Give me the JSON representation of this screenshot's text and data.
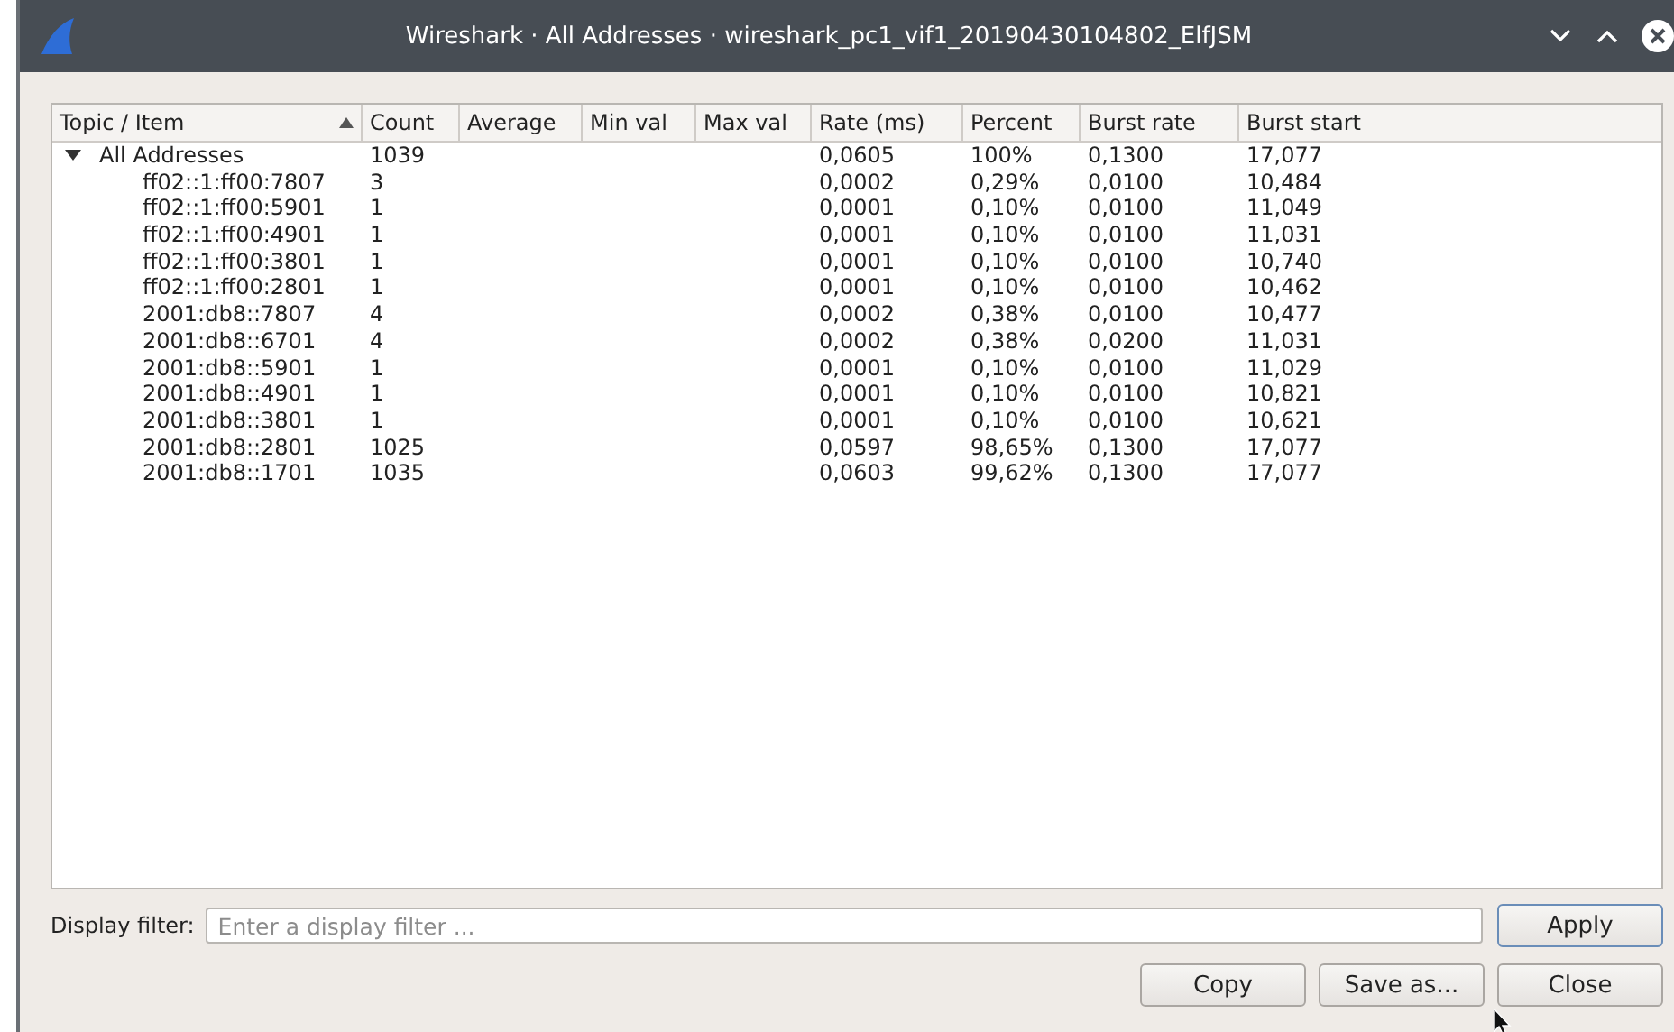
{
  "window": {
    "title": "Wireshark · All Addresses · wireshark_pc1_vif1_20190430104802_ElfJSM"
  },
  "table": {
    "columns": [
      {
        "label": "Topic / Item",
        "sorted": true
      },
      {
        "label": "Count",
        "sorted": false
      },
      {
        "label": "Average",
        "sorted": false
      },
      {
        "label": "Min val",
        "sorted": false
      },
      {
        "label": "Max val",
        "sorted": false
      },
      {
        "label": "Rate (ms)",
        "sorted": false
      },
      {
        "label": "Percent",
        "sorted": false
      },
      {
        "label": "Burst rate",
        "sorted": false
      },
      {
        "label": "Burst start",
        "sorted": false
      }
    ],
    "rows": [
      {
        "cells": [
          "All Addresses",
          "1039",
          "",
          "",
          "",
          "0,0605",
          "100%",
          "0,1300",
          "17,077"
        ],
        "expanded": true,
        "children": [
          {
            "cells": [
              "ff02::1:ff00:7807",
              "3",
              "",
              "",
              "",
              "0,0002",
              "0,29%",
              "0,0100",
              "10,484"
            ]
          },
          {
            "cells": [
              "ff02::1:ff00:5901",
              "1",
              "",
              "",
              "",
              "0,0001",
              "0,10%",
              "0,0100",
              "11,049"
            ]
          },
          {
            "cells": [
              "ff02::1:ff00:4901",
              "1",
              "",
              "",
              "",
              "0,0001",
              "0,10%",
              "0,0100",
              "11,031"
            ]
          },
          {
            "cells": [
              "ff02::1:ff00:3801",
              "1",
              "",
              "",
              "",
              "0,0001",
              "0,10%",
              "0,0100",
              "10,740"
            ]
          },
          {
            "cells": [
              "ff02::1:ff00:2801",
              "1",
              "",
              "",
              "",
              "0,0001",
              "0,10%",
              "0,0100",
              "10,462"
            ]
          },
          {
            "cells": [
              "2001:db8::7807",
              "4",
              "",
              "",
              "",
              "0,0002",
              "0,38%",
              "0,0100",
              "10,477"
            ]
          },
          {
            "cells": [
              "2001:db8::6701",
              "4",
              "",
              "",
              "",
              "0,0002",
              "0,38%",
              "0,0200",
              "11,031"
            ]
          },
          {
            "cells": [
              "2001:db8::5901",
              "1",
              "",
              "",
              "",
              "0,0001",
              "0,10%",
              "0,0100",
              "11,029"
            ]
          },
          {
            "cells": [
              "2001:db8::4901",
              "1",
              "",
              "",
              "",
              "0,0001",
              "0,10%",
              "0,0100",
              "10,821"
            ]
          },
          {
            "cells": [
              "2001:db8::3801",
              "1",
              "",
              "",
              "",
              "0,0001",
              "0,10%",
              "0,0100",
              "10,621"
            ]
          },
          {
            "cells": [
              "2001:db8::2801",
              "1025",
              "",
              "",
              "",
              "0,0597",
              "98,65%",
              "0,1300",
              "17,077"
            ]
          },
          {
            "cells": [
              "2001:db8::1701",
              "1035",
              "",
              "",
              "",
              "0,0603",
              "99,62%",
              "0,1300",
              "17,077"
            ]
          }
        ]
      }
    ]
  },
  "display_filter": {
    "label": "Display filter:",
    "placeholder": "Enter a display filter ...",
    "button": "Apply"
  },
  "buttons": [
    "Copy",
    "Save as...",
    "Close"
  ]
}
